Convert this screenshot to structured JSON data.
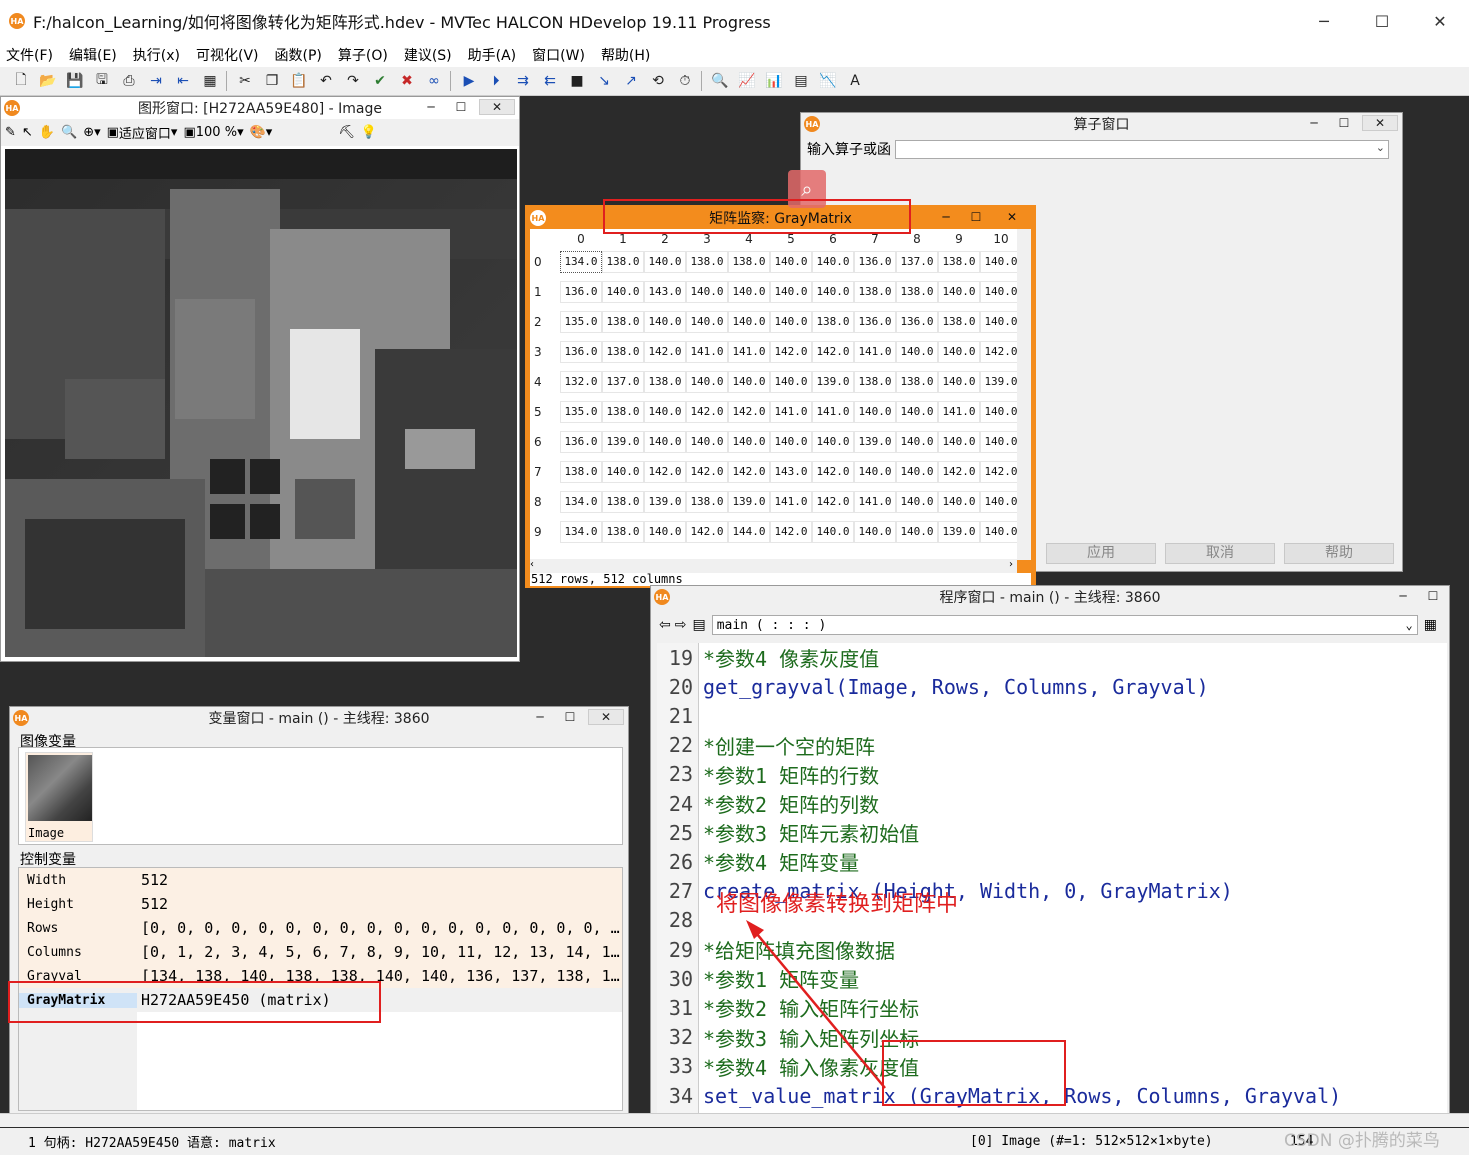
{
  "app": {
    "title": "F:/halcon_Learning/如何将图像转化为矩阵形式.hdev - MVTec HALCON HDevelop 19.11 Progress",
    "logo": "HA",
    "window_controls": [
      "─",
      "☐",
      "✕"
    ]
  },
  "menu": [
    "文件(F)",
    "编辑(E)",
    "执行(x)",
    "可视化(V)",
    "函数(P)",
    "算子(O)",
    "建议(S)",
    "助手(A)",
    "窗口(W)",
    "帮助(H)"
  ],
  "toolbar_icons": [
    "new-file-icon",
    "open-file-icon",
    "save-icon",
    "save-as-icon",
    "print-icon",
    "cut-icon",
    "copy-icon",
    "paste-icon",
    "undo-icon",
    "redo-icon",
    "run-icon",
    "step-icon",
    "stop-icon",
    "binoculars-icon",
    "graph-icon",
    "chart-icon",
    "histogram-icon"
  ],
  "graphics_window": {
    "title": "图形窗口: [H272AA59E480] - Image",
    "fit_label": "适应窗口",
    "zoom": "100 %"
  },
  "operator_window": {
    "title": "算子窗口",
    "input_label": "输入算子或函",
    "input_value": "",
    "buttons": [
      "应用",
      "取消",
      "帮助"
    ]
  },
  "matrix_window": {
    "title": "矩阵监察: GrayMatrix",
    "columns": [
      "0",
      "1",
      "2",
      "3",
      "4",
      "5",
      "6",
      "7",
      "8",
      "9",
      "10"
    ],
    "rows": [
      {
        "index": "0",
        "values": [
          "134.0",
          "138.0",
          "140.0",
          "138.0",
          "138.0",
          "140.0",
          "140.0",
          "136.0",
          "137.0",
          "138.0",
          "140.0"
        ]
      },
      {
        "index": "1",
        "values": [
          "136.0",
          "140.0",
          "143.0",
          "140.0",
          "140.0",
          "140.0",
          "140.0",
          "138.0",
          "138.0",
          "140.0",
          "140.0"
        ]
      },
      {
        "index": "2",
        "values": [
          "135.0",
          "138.0",
          "140.0",
          "140.0",
          "140.0",
          "140.0",
          "138.0",
          "136.0",
          "136.0",
          "138.0",
          "140.0"
        ]
      },
      {
        "index": "3",
        "values": [
          "136.0",
          "138.0",
          "142.0",
          "141.0",
          "141.0",
          "142.0",
          "142.0",
          "141.0",
          "140.0",
          "140.0",
          "142.0"
        ]
      },
      {
        "index": "4",
        "values": [
          "132.0",
          "137.0",
          "138.0",
          "140.0",
          "140.0",
          "140.0",
          "139.0",
          "138.0",
          "138.0",
          "140.0",
          "139.0"
        ]
      },
      {
        "index": "5",
        "values": [
          "135.0",
          "138.0",
          "140.0",
          "142.0",
          "142.0",
          "141.0",
          "141.0",
          "140.0",
          "140.0",
          "141.0",
          "140.0"
        ]
      },
      {
        "index": "6",
        "values": [
          "136.0",
          "139.0",
          "140.0",
          "140.0",
          "140.0",
          "140.0",
          "140.0",
          "139.0",
          "140.0",
          "140.0",
          "140.0"
        ]
      },
      {
        "index": "7",
        "values": [
          "138.0",
          "140.0",
          "142.0",
          "142.0",
          "142.0",
          "143.0",
          "142.0",
          "140.0",
          "140.0",
          "142.0",
          "142.0"
        ]
      },
      {
        "index": "8",
        "values": [
          "134.0",
          "138.0",
          "139.0",
          "138.0",
          "139.0",
          "141.0",
          "142.0",
          "141.0",
          "140.0",
          "140.0",
          "140.0"
        ]
      },
      {
        "index": "9",
        "values": [
          "134.0",
          "138.0",
          "140.0",
          "142.0",
          "144.0",
          "142.0",
          "140.0",
          "140.0",
          "140.0",
          "139.0",
          "140.0"
        ]
      }
    ],
    "status": "512 rows,  512 columns"
  },
  "variable_window": {
    "title": "变量窗口 - main () - 主线程: 3860",
    "image_section": "图像变量",
    "image_var": "Image",
    "control_section": "控制变量",
    "controls": [
      {
        "name": "Width",
        "value": "512"
      },
      {
        "name": "Height",
        "value": "512"
      },
      {
        "name": "Rows",
        "value": "[0, 0, 0, 0, 0, 0, 0, 0, 0, 0, 0, 0, 0, 0, 0, 0, 0, …"
      },
      {
        "name": "Columns",
        "value": "[0, 1, 2, 3, 4, 5, 6, 7, 8, 9, 10, 11, 12, 13, 14, 1…"
      },
      {
        "name": "Grayval",
        "value": "[134, 138, 140, 138, 138, 140, 140, 136, 137, 138, 1…"
      },
      {
        "name": "GrayMatrix",
        "value": "H272AA59E450 (matrix)"
      }
    ]
  },
  "program_window": {
    "title": "程序窗口 - main () - 主线程: 3860",
    "procedure": "main ( : : : )",
    "lines": [
      {
        "num": "19",
        "text": "*参数4 像素灰度值",
        "kind": "comment"
      },
      {
        "num": "20",
        "text": "get_grayval(Image, Rows, Columns, Grayval)",
        "kind": "op"
      },
      {
        "num": "21",
        "text": "",
        "kind": "op"
      },
      {
        "num": "22",
        "text": "*创建一个空的矩阵",
        "kind": "comment"
      },
      {
        "num": "23",
        "text": "*参数1 矩阵的行数",
        "kind": "comment"
      },
      {
        "num": "24",
        "text": "*参数2 矩阵的列数",
        "kind": "comment"
      },
      {
        "num": "25",
        "text": "*参数3 矩阵元素初始值",
        "kind": "comment"
      },
      {
        "num": "26",
        "text": "*参数4 矩阵变量",
        "kind": "comment"
      },
      {
        "num": "27",
        "text": "create_matrix (Height, Width, 0, GrayMatrix)",
        "kind": "op"
      },
      {
        "num": "28",
        "text": "",
        "kind": "op"
      },
      {
        "num": "29",
        "text": "*给矩阵填充图像数据",
        "kind": "comment"
      },
      {
        "num": "30",
        "text": "*参数1 矩阵变量",
        "kind": "comment"
      },
      {
        "num": "31",
        "text": "*参数2 输入矩阵行坐标",
        "kind": "comment"
      },
      {
        "num": "32",
        "text": "*参数3 输入矩阵列坐标",
        "kind": "comment"
      },
      {
        "num": "33",
        "text": "*参数4 输入像素灰度值",
        "kind": "comment"
      },
      {
        "num": "34",
        "text": "set_value_matrix (GrayMatrix, Rows, Columns, Grayval)",
        "kind": "op"
      },
      {
        "num": "35",
        "text": "",
        "kind": "op"
      }
    ]
  },
  "annotation": {
    "text": "将图像像素转换到矩阵中",
    "color": "#e01f1f"
  },
  "status_bar": {
    "left": "1 句柄: H272AA59E450 语意: matrix",
    "right": "[0] Image (#=1: 512×512×1×byte)",
    "right2": "154"
  },
  "watermark": "CSDN @扑腾的菜鸟",
  "colors": {
    "accent": "#f38c1d",
    "annotation": "#e01f1f",
    "comment": "#1d6b1d",
    "operator": "#1a2b9c"
  }
}
